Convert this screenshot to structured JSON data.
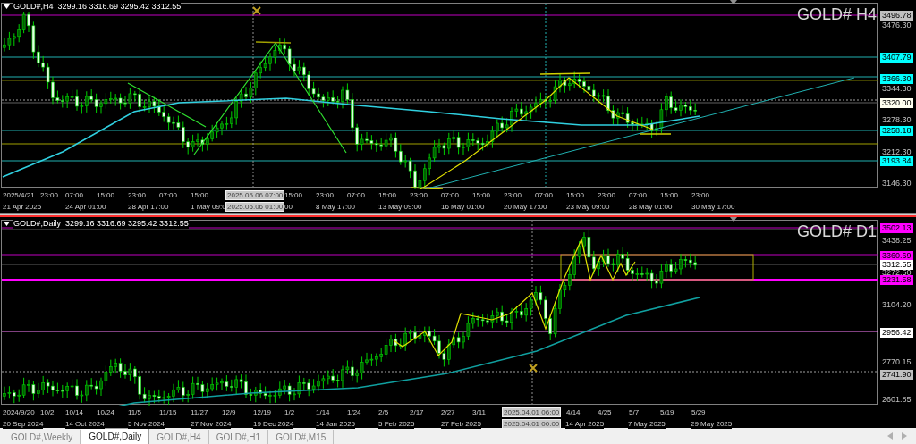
{
  "charts": [
    {
      "header": "GOLD#,H4  3299.16 3316.69 3295.42 3312.55",
      "title": "GOLD# H4",
      "price_labels": [
        {
          "text": "3496.78",
          "kind": "tag",
          "color": "#c0c0c0"
        },
        {
          "text": "3476.30",
          "kind": "tick"
        },
        {
          "text": "3407.79",
          "kind": "tag",
          "color": "#00ffff"
        },
        {
          "text": "3366.30",
          "kind": "tag",
          "color": "#00ffff"
        },
        {
          "text": "3344.30",
          "kind": "tick"
        },
        {
          "text": "3320.00",
          "kind": "tag",
          "color": "#fffff0"
        },
        {
          "text": "3278.30",
          "kind": "tick"
        },
        {
          "text": "3258.18",
          "kind": "tag",
          "color": "#00ffff"
        },
        {
          "text": "3212.30",
          "kind": "tick"
        },
        {
          "text": "3193.84",
          "kind": "tag",
          "color": "#00ffff"
        },
        {
          "text": "3146.30",
          "kind": "tick"
        }
      ],
      "time_row_1": [
        {
          "text": "2025/4/21",
          "kind": "tick"
        },
        {
          "text": "23:00",
          "kind": "tick"
        },
        {
          "text": "07:00",
          "kind": "tick"
        },
        {
          "text": "15:00",
          "kind": "tick"
        },
        {
          "text": "23:00",
          "kind": "tick"
        },
        {
          "text": "07:00",
          "kind": "tick"
        },
        {
          "text": "15:00",
          "kind": "tick"
        },
        {
          "text": "2025.05.06 07:00",
          "kind": "tag"
        },
        {
          "text": "15:00",
          "kind": "tick"
        },
        {
          "text": "23:00",
          "kind": "tick"
        },
        {
          "text": "07:00",
          "kind": "tick"
        },
        {
          "text": "15:00",
          "kind": "tick"
        },
        {
          "text": "23:00",
          "kind": "tick"
        },
        {
          "text": "07:00",
          "kind": "tick"
        },
        {
          "text": "15:00",
          "kind": "tick"
        },
        {
          "text": "23:00",
          "kind": "tick"
        },
        {
          "text": "07:00",
          "kind": "tick"
        },
        {
          "text": "15:00",
          "kind": "tick"
        },
        {
          "text": "23:00",
          "kind": "tick"
        },
        {
          "text": "07:00",
          "kind": "tick"
        },
        {
          "text": "15:00",
          "kind": "tick"
        },
        {
          "text": "23:00",
          "kind": "tick"
        }
      ],
      "time_row_2": [
        {
          "text": "21 Apr 2025",
          "kind": "tick"
        },
        {
          "text": "24 Apr 01:00",
          "kind": "tick"
        },
        {
          "text": "28 Apr 17:00",
          "kind": "tick"
        },
        {
          "text": "1 May 09:0",
          "kind": "tick"
        },
        {
          "text": "2025.05.06 01:00",
          "kind": "tag"
        },
        {
          "text": "00",
          "kind": "tick"
        },
        {
          "text": "8 May 17:00",
          "kind": "tick"
        },
        {
          "text": "13 May 09:00",
          "kind": "tick"
        },
        {
          "text": "16 May 01:00",
          "kind": "tick"
        },
        {
          "text": "20 May 17:00",
          "kind": "tick"
        },
        {
          "text": "23 May 09:00",
          "kind": "tick"
        },
        {
          "text": "28 May 01:00",
          "kind": "tick"
        },
        {
          "text": "30 May 17:00",
          "kind": "tick"
        }
      ]
    },
    {
      "header": "GOLD#,Daily  3299.16 3316.69 3295.42 3312.55",
      "title": "GOLD# D1",
      "price_labels": [
        {
          "text": "3502.13",
          "kind": "tag",
          "color": "#ff00ff"
        },
        {
          "text": "3438.25",
          "kind": "tick"
        },
        {
          "text": "3360.69",
          "kind": "tag",
          "color": "#ff00ff"
        },
        {
          "text": "3312.55",
          "kind": "tag",
          "color": "#ffffff"
        },
        {
          "text": "3272.50",
          "kind": "tick"
        },
        {
          "text": "3231.58",
          "kind": "tag",
          "color": "#ff00ff"
        },
        {
          "text": "3104.20",
          "kind": "tick"
        },
        {
          "text": "2956.42",
          "kind": "tag",
          "color": "#ffffff"
        },
        {
          "text": "2770.15",
          "kind": "tick"
        },
        {
          "text": "2741.90",
          "kind": "tag",
          "color": "#c0c0c0"
        },
        {
          "text": "2601.85",
          "kind": "tick"
        }
      ],
      "time_row_1": [
        {
          "text": "2024/9/20",
          "kind": "tick"
        },
        {
          "text": "10/2",
          "kind": "tick"
        },
        {
          "text": "10/14",
          "kind": "tick"
        },
        {
          "text": "10/24",
          "kind": "tick"
        },
        {
          "text": "11/5",
          "kind": "tick"
        },
        {
          "text": "11/15",
          "kind": "tick"
        },
        {
          "text": "11/27",
          "kind": "tick"
        },
        {
          "text": "12/9",
          "kind": "tick"
        },
        {
          "text": "12/19",
          "kind": "tick"
        },
        {
          "text": "1/2",
          "kind": "tick"
        },
        {
          "text": "1/14",
          "kind": "tick"
        },
        {
          "text": "1/24",
          "kind": "tick"
        },
        {
          "text": "2/5",
          "kind": "tick"
        },
        {
          "text": "2/17",
          "kind": "tick"
        },
        {
          "text": "2/27",
          "kind": "tick"
        },
        {
          "text": "3/11",
          "kind": "tick"
        },
        {
          "text": "2025.04.01 06:00",
          "kind": "tag"
        },
        {
          "text": "4/14",
          "kind": "tick"
        },
        {
          "text": "4/25",
          "kind": "tick"
        },
        {
          "text": "5/7",
          "kind": "tick"
        },
        {
          "text": "5/19",
          "kind": "tick"
        },
        {
          "text": "5/29",
          "kind": "tick"
        }
      ],
      "time_row_2": [
        {
          "text": "20 Sep 2024",
          "kind": "tick"
        },
        {
          "text": "14 Oct 2024",
          "kind": "tick"
        },
        {
          "text": "5 Nov 2024",
          "kind": "tick"
        },
        {
          "text": "27 Nov 2024",
          "kind": "tick"
        },
        {
          "text": "19 Dec 2024",
          "kind": "tick"
        },
        {
          "text": "14 Jan 2025",
          "kind": "tick"
        },
        {
          "text": "5 Feb 2025",
          "kind": "tick"
        },
        {
          "text": "27 Feb 2025",
          "kind": "tick"
        },
        {
          "text": "2025.04.01 00:00",
          "kind": "tag"
        },
        {
          "text": "14 Apr 2025",
          "kind": "tick"
        },
        {
          "text": "7 May 2025",
          "kind": "tick"
        },
        {
          "text": "29 May 2025",
          "kind": "tick"
        }
      ]
    }
  ],
  "tabs": [
    {
      "label": "GOLD#,Weekly",
      "selected": false
    },
    {
      "label": "GOLD#,Daily",
      "selected": true
    },
    {
      "label": "GOLD#,H4",
      "selected": false
    },
    {
      "label": "GOLD#,H1",
      "selected": false
    },
    {
      "label": "GOLD#,M15",
      "selected": false
    }
  ]
}
